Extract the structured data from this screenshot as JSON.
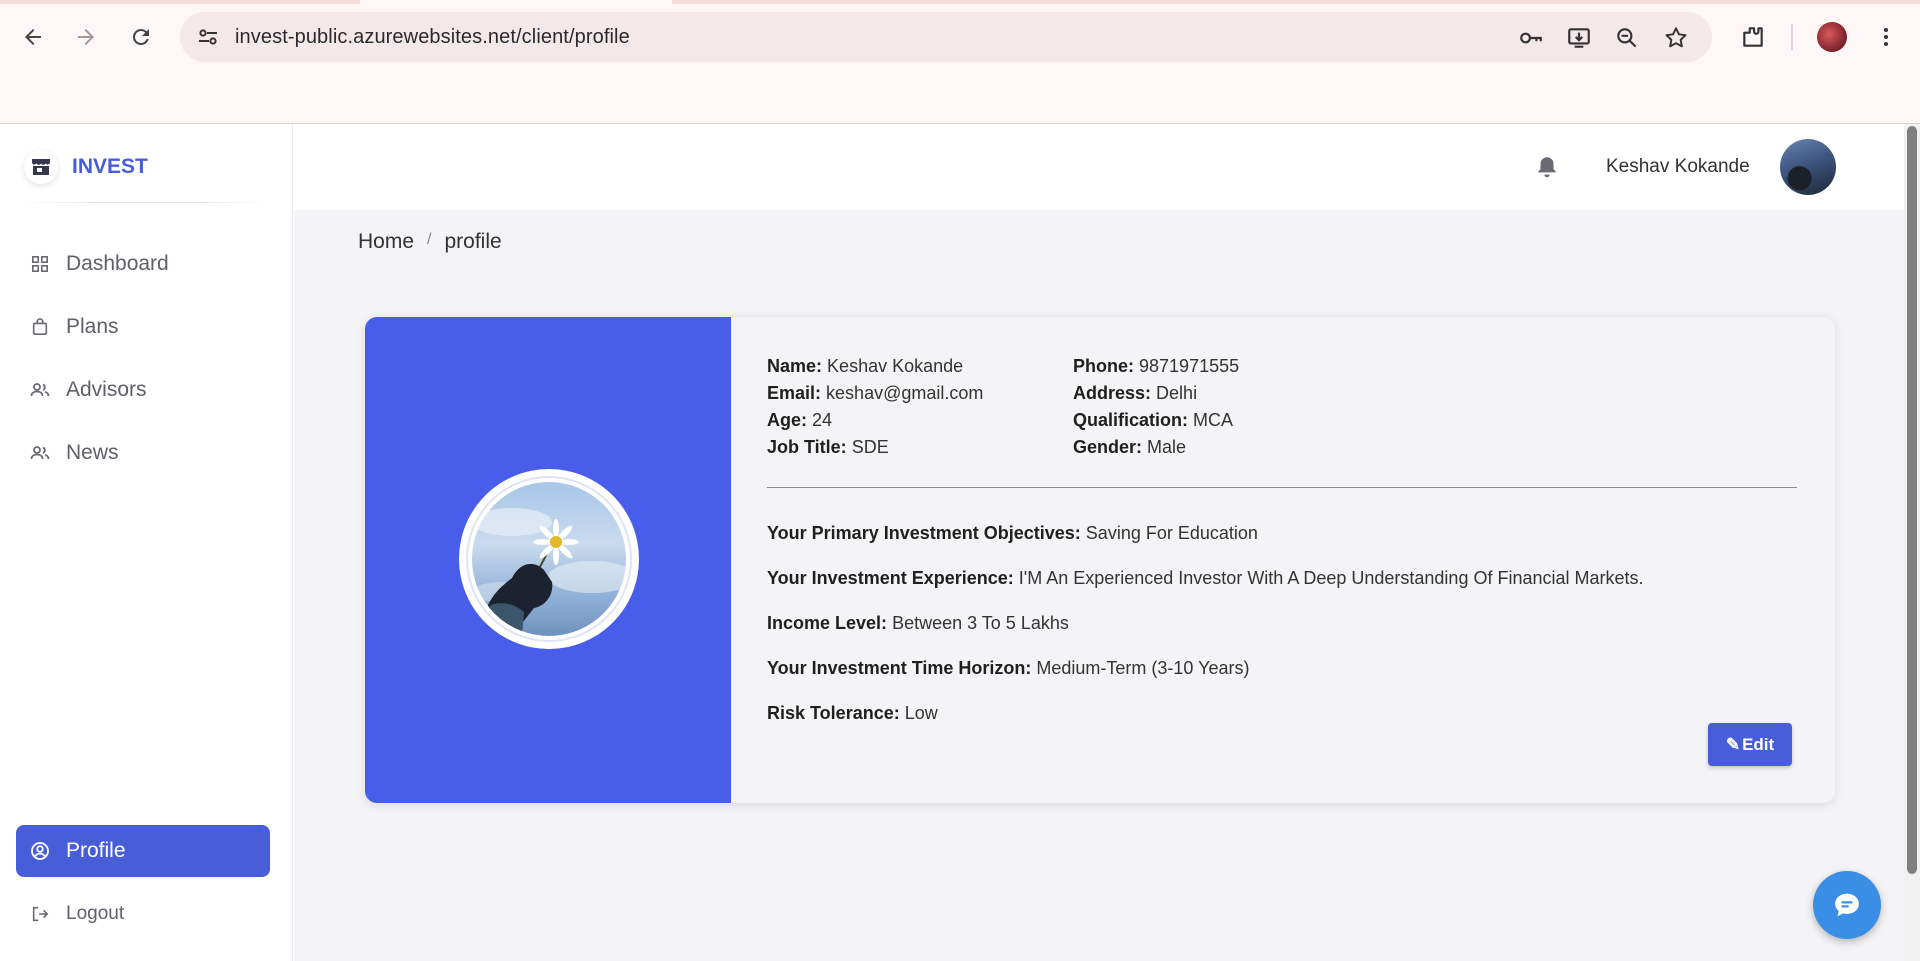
{
  "browser": {
    "url": "invest-public.azurewebsites.net/client/profile",
    "icons": [
      "back-icon",
      "forward-icon",
      "reload-icon",
      "site-settings-icon",
      "password-key-icon",
      "install-app-icon",
      "zoom-icon",
      "bookmark-star-icon",
      "extensions-icon",
      "profile-avatar",
      "more-menu-icon"
    ]
  },
  "sidebar": {
    "brand": "INVEST",
    "items": [
      {
        "label": "Dashboard",
        "icon": "grid-icon"
      },
      {
        "label": "Plans",
        "icon": "shopping-bag-icon"
      },
      {
        "label": "Advisors",
        "icon": "users-icon"
      },
      {
        "label": "News",
        "icon": "users-icon"
      }
    ],
    "bottom": [
      {
        "label": "Profile",
        "icon": "user-circle-icon",
        "active": true
      },
      {
        "label": "Logout",
        "icon": "logout-icon"
      }
    ]
  },
  "topbar": {
    "user_name": "Keshav Kokande"
  },
  "breadcrumb": {
    "home": "Home",
    "sep": "/",
    "current": "profile"
  },
  "profile": {
    "left": [
      {
        "label": "Name:",
        "value": "Keshav Kokande"
      },
      {
        "label": "Email:",
        "value": "keshav@gmail.com"
      },
      {
        "label": "Age:",
        "value": "24"
      },
      {
        "label": "Job Title:",
        "value": "SDE"
      }
    ],
    "right": [
      {
        "label": "Phone:",
        "value": "9871971555"
      },
      {
        "label": "Address:",
        "value": "Delhi"
      },
      {
        "label": "Qualification:",
        "value": "MCA"
      },
      {
        "label": "Gender:",
        "value": "Male"
      }
    ],
    "investment": [
      {
        "label": "Your Primary Investment Objectives:",
        "value": "Saving For Education"
      },
      {
        "label": "Your Investment Experience:",
        "value": "I'M An Experienced Investor With A Deep Understanding Of Financial Markets."
      },
      {
        "label": "Income Level:",
        "value": "Between 3 To 5 Lakhs"
      },
      {
        "label": "Your Investment Time Horizon:",
        "value": "Medium-Term (3-10 Years)"
      },
      {
        "label": "Risk Tolerance:",
        "value": "Low"
      }
    ],
    "edit_label": "Edit",
    "edit_glyph": "✎"
  },
  "colors": {
    "accent": "#485dd8",
    "card_left": "#485dea",
    "chat_fab": "#3b8ee6"
  }
}
